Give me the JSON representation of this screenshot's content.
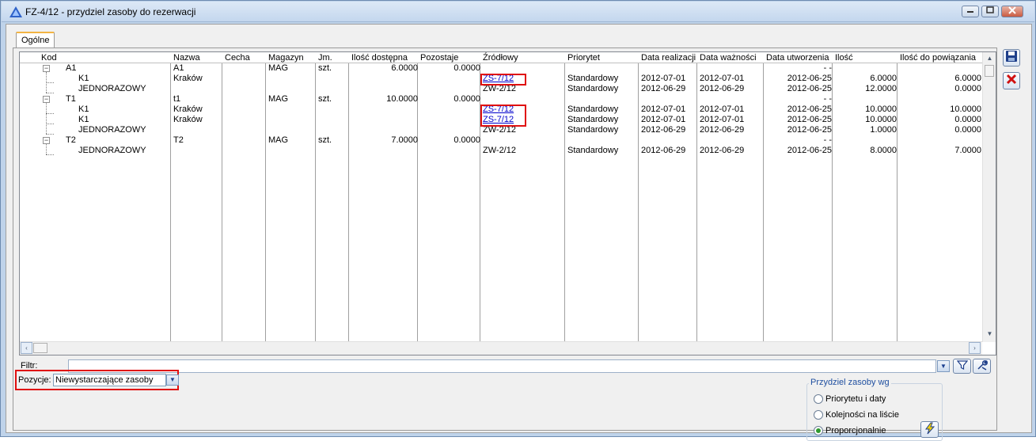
{
  "window": {
    "title": "FZ-4/12 - przydziel zasoby do rezerwacji",
    "minimize": "▭",
    "maximize": "▭",
    "close": "✕"
  },
  "tabs": [
    "Ogólne"
  ],
  "grid": {
    "columns": [
      "Kod",
      "Nazwa",
      "Cecha",
      "Magazyn",
      "Jm.",
      "Ilość dostępna",
      "Pozostaje",
      "Źródłowy",
      "Priorytet",
      "Data realizacji",
      "Data ważności",
      "Data utworzenia",
      "Ilość",
      "Ilość do powiązania"
    ],
    "rows": [
      {
        "kod": "A1",
        "nazwa": "A1",
        "cecha": "",
        "magazyn": "MAG",
        "jm": "szt.",
        "ilosc_dostepna": "6.0000",
        "pozostaje": "0.0000",
        "zrodlowy": "",
        "priorytet": "",
        "data_realizacji": "",
        "data_waznosci": "",
        "data_utworzenia": "- -",
        "ilosc": "",
        "ilosc_do_powiazania": ""
      },
      {
        "kod": "K1",
        "nazwa": "Kraków",
        "cecha": "",
        "magazyn": "",
        "jm": "",
        "ilosc_dostepna": "",
        "pozostaje": "",
        "zrodlowy": "ZS-7/12",
        "priorytet": "Standardowy",
        "data_realizacji": "2012-07-01",
        "data_waznosci": "2012-07-01",
        "data_utworzenia": "2012-06-25",
        "ilosc": "6.0000",
        "ilosc_do_powiazania": "6.0000"
      },
      {
        "kod": "JEDNORAZOWY",
        "nazwa": "",
        "cecha": "",
        "magazyn": "",
        "jm": "",
        "ilosc_dostepna": "",
        "pozostaje": "",
        "zrodlowy": "ZW-2/12",
        "priorytet": "Standardowy",
        "data_realizacji": "2012-06-29",
        "data_waznosci": "2012-06-29",
        "data_utworzenia": "2012-06-25",
        "ilosc": "12.0000",
        "ilosc_do_powiazania": "0.0000"
      },
      {
        "kod": "T1",
        "nazwa": "t1",
        "cecha": "",
        "magazyn": "MAG",
        "jm": "szt.",
        "ilosc_dostepna": "10.0000",
        "pozostaje": "0.0000",
        "zrodlowy": "",
        "priorytet": "",
        "data_realizacji": "",
        "data_waznosci": "",
        "data_utworzenia": "- -",
        "ilosc": "",
        "ilosc_do_powiazania": ""
      },
      {
        "kod": "K1",
        "nazwa": "Kraków",
        "cecha": "",
        "magazyn": "",
        "jm": "",
        "ilosc_dostepna": "",
        "pozostaje": "",
        "zrodlowy": "ZS-7/12",
        "priorytet": "Standardowy",
        "data_realizacji": "2012-07-01",
        "data_waznosci": "2012-07-01",
        "data_utworzenia": "2012-06-25",
        "ilosc": "10.0000",
        "ilosc_do_powiazania": "10.0000"
      },
      {
        "kod": "K1",
        "nazwa": "Kraków",
        "cecha": "",
        "magazyn": "",
        "jm": "",
        "ilosc_dostepna": "",
        "pozostaje": "",
        "zrodlowy": "ZS-7/12",
        "priorytet": "Standardowy",
        "data_realizacji": "2012-07-01",
        "data_waznosci": "2012-07-01",
        "data_utworzenia": "2012-06-25",
        "ilosc": "10.0000",
        "ilosc_do_powiazania": "0.0000"
      },
      {
        "kod": "JEDNORAZOWY",
        "nazwa": "",
        "cecha": "",
        "magazyn": "",
        "jm": "",
        "ilosc_dostepna": "",
        "pozostaje": "",
        "zrodlowy": "ZW-2/12",
        "priorytet": "Standardowy",
        "data_realizacji": "2012-06-29",
        "data_waznosci": "2012-06-29",
        "data_utworzenia": "2012-06-25",
        "ilosc": "1.0000",
        "ilosc_do_powiazania": "0.0000"
      },
      {
        "kod": "T2",
        "nazwa": "T2",
        "cecha": "",
        "magazyn": "MAG",
        "jm": "szt.",
        "ilosc_dostepna": "7.0000",
        "pozostaje": "0.0000",
        "zrodlowy": "",
        "priorytet": "",
        "data_realizacji": "",
        "data_waznosci": "",
        "data_utworzenia": "- -",
        "ilosc": "",
        "ilosc_do_powiazania": ""
      },
      {
        "kod": "JEDNORAZOWY",
        "nazwa": "",
        "cecha": "",
        "magazyn": "",
        "jm": "",
        "ilosc_dostepna": "",
        "pozostaje": "",
        "zrodlowy": "ZW-2/12",
        "priorytet": "Standardowy",
        "data_realizacji": "2012-06-29",
        "data_waznosci": "2012-06-29",
        "data_utworzenia": "2012-06-25",
        "ilosc": "8.0000",
        "ilosc_do_powiazania": "7.0000"
      }
    ]
  },
  "filter": {
    "label": "Filtr:",
    "value": ""
  },
  "pozycje": {
    "label": "Pozycje:",
    "value": "Niewystarczające zasoby"
  },
  "przydziel": {
    "title": "Przydziel zasoby wg",
    "options": [
      "Priorytetu i daty",
      "Kolejności na liście",
      "Proporcjonalnie"
    ],
    "selected": "Proporcjonalnie"
  },
  "icons": {
    "save": "save-icon",
    "cancel": "cancel-icon",
    "filter": "funnel-icon",
    "filter_settings": "wrench-icon",
    "execute": "lightning-icon"
  },
  "colors": {
    "title_bar": "#c4d7ee",
    "highlight": "#e01010",
    "link": "#0000cc",
    "group_title": "#1f4fa0"
  }
}
